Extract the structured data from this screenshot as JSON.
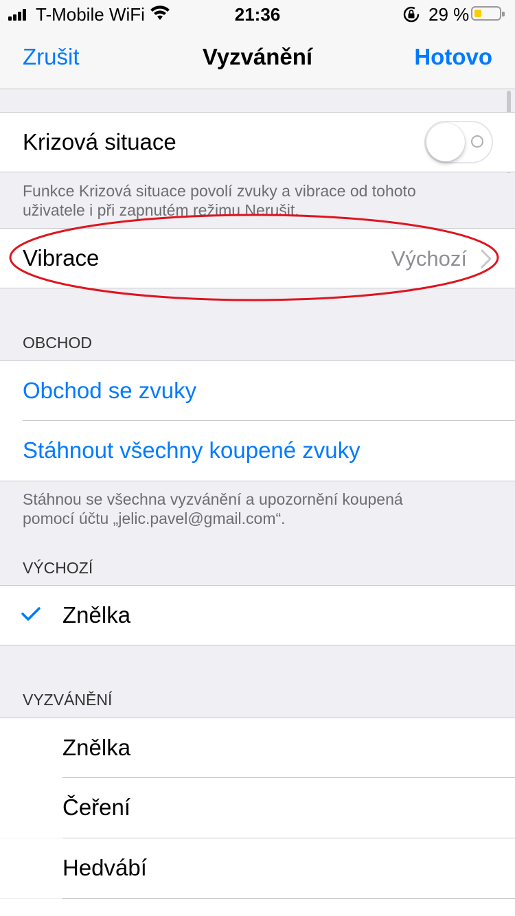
{
  "status_bar": {
    "carrier": "T-Mobile WiFi",
    "time": "21:36",
    "battery_pct_label": "29 %",
    "battery_level": 0.29,
    "icons": [
      "signal-icon",
      "wifi-icon",
      "orientation-lock-icon",
      "battery-icon"
    ]
  },
  "nav": {
    "cancel_label": "Zrušit",
    "title": "Vyzvánění",
    "done_label": "Hotovo"
  },
  "emergency": {
    "label": "Krizová situace",
    "enabled": false,
    "footer_line1": "Funkce Krizová situace povolí zvuky a vibrace od tohoto",
    "footer_line2": "uživatele i při zapnutém režimu Nerušit."
  },
  "vibration": {
    "label": "Vibrace",
    "value": "Výchozí"
  },
  "store": {
    "header": "OBCHOD",
    "items": [
      {
        "label": "Obchod se zvuky"
      },
      {
        "label": "Stáhnout všechny koupené zvuky"
      }
    ],
    "footer_line1": "Stáhnou se všechna vyzvánění a upozornění koupená",
    "footer_line2": "pomocí účtu „jelic.pavel@gmail.com“."
  },
  "default_section": {
    "header": "VÝCHOZÍ",
    "items": [
      {
        "label": "Znělka",
        "selected": true
      }
    ]
  },
  "ringtones": {
    "header": "VYZVÁNĚNÍ",
    "items": [
      {
        "label": "Znělka"
      },
      {
        "label": "Čeření"
      },
      {
        "label": "Hedvábí"
      }
    ]
  },
  "colors": {
    "accent": "#007aff",
    "annotation": "#e0141e",
    "background": "#efeff4",
    "battery_fill": "#ffcc00"
  }
}
